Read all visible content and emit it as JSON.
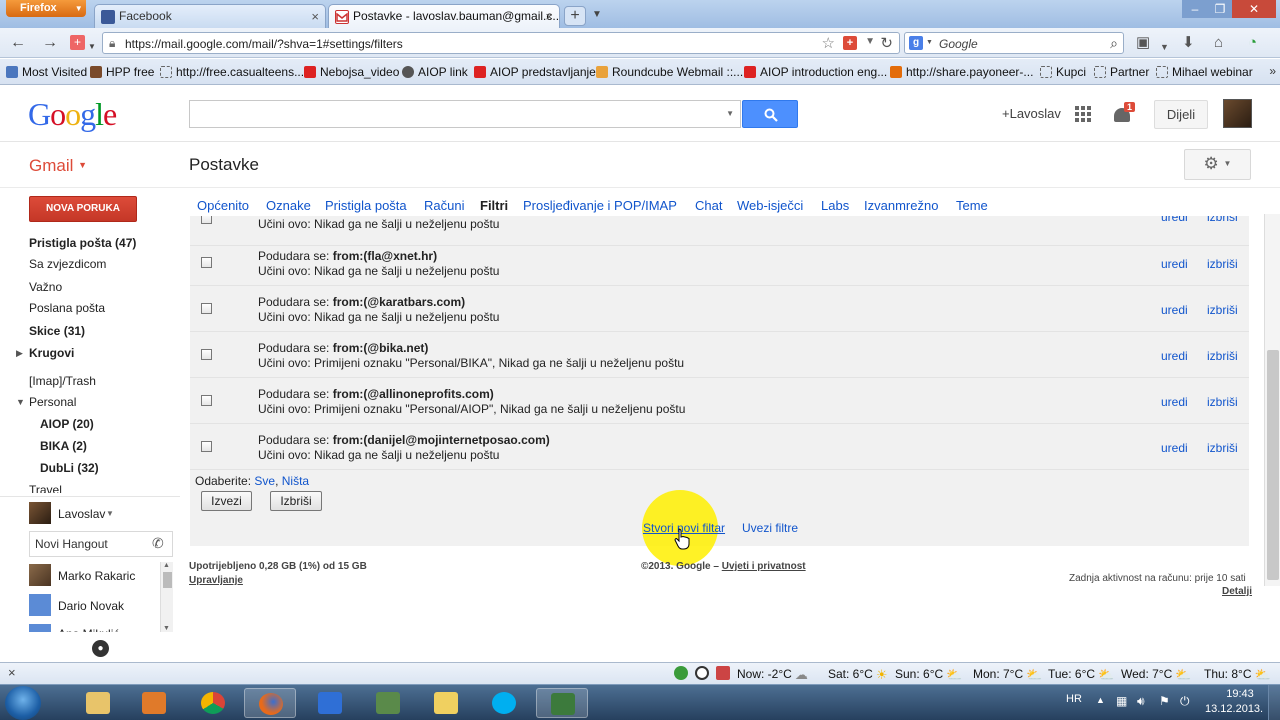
{
  "browser": {
    "menu_label": "Firefox",
    "tabs": [
      {
        "title": "Facebook",
        "close": "×"
      },
      {
        "title": "Postavke - lavoslav.bauman@gmail.c...",
        "close": "×"
      }
    ],
    "new_tab": "+",
    "url": "https://mail.google.com/mail/?shva=1#settings/filters",
    "search_placeholder": "Google",
    "bookmarks": [
      "Most Visited",
      "HPP free",
      "http://free.casualteens...",
      "Nebojsa_video",
      "AIOP link",
      "AIOP predstavljanje",
      "Roundcube Webmail ::...",
      "AIOP introduction eng...",
      "http://share.payoneer-...",
      "Kupci",
      "Partner",
      "Mihael webinar"
    ],
    "bookmarks_more": "»"
  },
  "gmail": {
    "logo_letters": [
      "G",
      "o",
      "o",
      "g",
      "l",
      "e"
    ],
    "logo_colors": [
      "#3369e8",
      "#d50f25",
      "#eeb211",
      "#3369e8",
      "#009925",
      "#d50f25"
    ],
    "plus_user": "+Lavoslav",
    "notification_count": "1",
    "share_label": "Dijeli",
    "app_menu": "Gmail",
    "page_title": "Postavke",
    "compose": "NOVA PORUKA",
    "nav": [
      {
        "label": "Pristigla pošta (47)",
        "bold": true
      },
      {
        "label": "Sa zvjezdicom",
        "bold": false
      },
      {
        "label": "Važno",
        "bold": false
      },
      {
        "label": "Poslana pošta",
        "bold": false
      },
      {
        "label": "Skice (31)",
        "bold": true
      },
      {
        "label": "Krugovi",
        "bold": true
      },
      {
        "label": "[Imap]/Trash",
        "bold": false
      },
      {
        "label": "Personal",
        "bold": false
      },
      {
        "label": "AIOP (20)",
        "bold": true
      },
      {
        "label": "BIKA (2)",
        "bold": true
      },
      {
        "label": "DubLi (32)",
        "bold": true
      },
      {
        "label": "Travel",
        "bold": false
      }
    ],
    "me_name": "Lavoslav",
    "hangout_placeholder": "Novi Hangout",
    "contacts": [
      "Marko Rakaric",
      "Dario Novak",
      "Ana Mikulić"
    ],
    "settings_tabs": [
      "Općenito",
      "Oznake",
      "Pristigla pošta",
      "Računi",
      "Filtri",
      "Prosljeđivanje i POP/IMAP",
      "Chat",
      "Web-isječci",
      "Labs",
      "Izvanmrežno",
      "Teme"
    ],
    "current_tab": "Filtri"
  },
  "filters": {
    "match_prefix": "Podudara se: ",
    "edit_label": "uredi",
    "delete_label": "izbriši",
    "rows": [
      {
        "match": "",
        "action": "Učini ovo: Nikad ga ne šalji u neželjenu poštu"
      },
      {
        "match": "from:(fla@xnet.hr)",
        "action": "Učini ovo: Nikad ga ne šalji u neželjenu poštu"
      },
      {
        "match": "from:(@karatbars.com)",
        "action": "Učini ovo: Nikad ga ne šalji u neželjenu poštu"
      },
      {
        "match": "from:(@bika.net)",
        "action": "Učini ovo: Primijeni oznaku \"Personal/BIKA\", Nikad ga ne šalji u neželjenu poštu"
      },
      {
        "match": "from:(@allinoneprofits.com)",
        "action": "Učini ovo: Primijeni oznaku \"Personal/AIOP\", Nikad ga ne šalji u neželjenu poštu"
      },
      {
        "match": "from:(danijel@mojinternetposao.com)",
        "action": "Učini ovo: Nikad ga ne šalji u neželjenu poštu"
      }
    ],
    "select_label": "Odaberite: ",
    "select_all": "Sve",
    "select_none": "Ništa",
    "export_btn": "Izvezi",
    "delete_btn": "Izbriši",
    "create_filter": "Stvori novi filtar",
    "import_filters": "Uvezi filtre"
  },
  "footer": {
    "storage": "Upotrijebljeno 0,28 GB (1%) od 15 GB",
    "manage": "Upravljanje",
    "copyright": "©2013. Google – ",
    "terms": "Uvjeti i privatnost",
    "activity": "Zadnja aktivnost na računu: prije 10 sati",
    "details": "Detalji"
  },
  "statusbar": {
    "close": "×",
    "weather": [
      {
        "label": "Now: -2°C",
        "icon": "cloud"
      },
      {
        "label": "Sat: 6°C",
        "icon": "sun"
      },
      {
        "label": "Sun: 6°C",
        "icon": "partly-cloudy"
      },
      {
        "label": "Mon: 7°C",
        "icon": "partly-cloudy"
      },
      {
        "label": "Tue: 6°C",
        "icon": "partly-cloudy"
      },
      {
        "label": "Wed: 7°C",
        "icon": "partly-cloudy"
      },
      {
        "label": "Thu: 8°C",
        "icon": "partly-cloudy"
      }
    ]
  },
  "taskbar": {
    "apps": [
      "explorer",
      "media-player",
      "chrome",
      "firefox",
      "app-blue",
      "app-green",
      "app-yellow",
      "skype",
      "camtasia"
    ],
    "active_app": "firefox",
    "language": "HR",
    "time": "19:43",
    "date": "13.12.2013."
  },
  "colors": {
    "link": "#1155cc",
    "compose_red": "#dd4b39",
    "search_blue": "#4d90fe"
  }
}
